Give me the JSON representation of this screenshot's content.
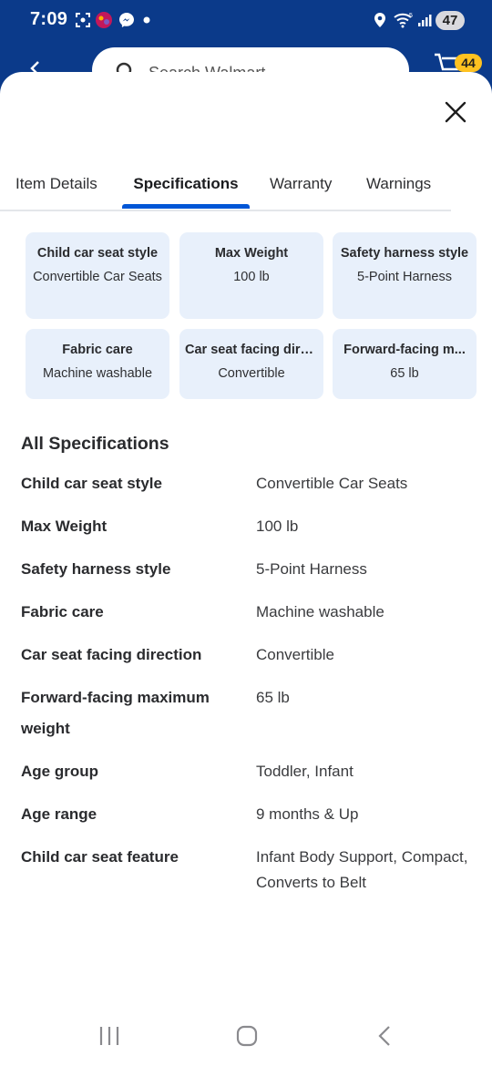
{
  "status_bar": {
    "time": "7:09",
    "battery": "47"
  },
  "background_header": {
    "search_placeholder": "Search Walmart",
    "cart_count": "44"
  },
  "tabs": [
    {
      "label": "Item Details",
      "selected": false
    },
    {
      "label": "Specifications",
      "selected": true
    },
    {
      "label": "Warranty",
      "selected": false
    },
    {
      "label": "Warnings",
      "selected": false
    }
  ],
  "highlight_cards": [
    {
      "title": "Child car seat style",
      "value": "Convertible Car Seats"
    },
    {
      "title": "Max Weight",
      "value": "100 lb"
    },
    {
      "title": "Safety harness style",
      "value": "5-Point Harness"
    },
    {
      "title": "Fabric care",
      "value": "Machine washable"
    },
    {
      "title": "Car seat facing dire...",
      "value": "Convertible"
    },
    {
      "title": "Forward-facing m...",
      "value": "65 lb"
    }
  ],
  "all_specifications": {
    "title": "All Specifications",
    "rows": [
      {
        "label": "Child car seat style",
        "value": "Convertible Car Seats"
      },
      {
        "label": "Max Weight",
        "value": "100 lb"
      },
      {
        "label": "Safety harness style",
        "value": "5-Point Harness"
      },
      {
        "label": "Fabric care",
        "value": "Machine washable"
      },
      {
        "label": "Car seat facing direction",
        "value": "Convertible"
      },
      {
        "label": "Forward-facing maximum weight",
        "value": "65 lb"
      },
      {
        "label": "Age group",
        "value": "Toddler, Infant"
      },
      {
        "label": "Age range",
        "value": "9 months & Up"
      },
      {
        "label": "Child car seat feature",
        "value": "Infant Body Support, Compact, Converts to Belt"
      }
    ]
  },
  "colors": {
    "brand_blue": "#0b3a8a",
    "tab_accent": "#0056d6",
    "card_bg": "#e8f0fb",
    "cart_badge": "#ffc220"
  }
}
